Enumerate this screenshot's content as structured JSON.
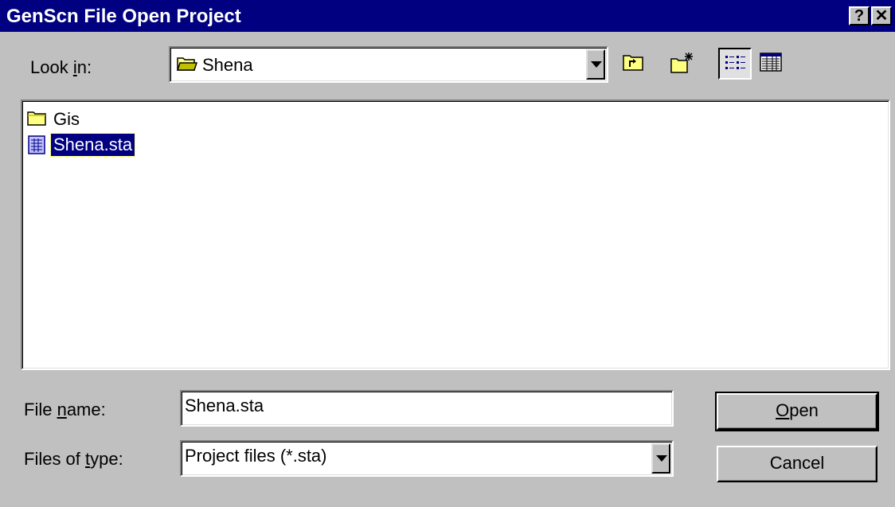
{
  "window": {
    "title": "GenScn File Open Project",
    "help_button": "?",
    "close_button": "✕"
  },
  "look_in": {
    "label_pre": "Look ",
    "label_accel": "i",
    "label_post": "n:",
    "value": "Shena"
  },
  "toolbar": {
    "icons": [
      "up-one-level-icon",
      "create-new-folder-icon",
      "list-view-icon",
      "details-view-icon"
    ]
  },
  "files": {
    "items": [
      {
        "name": "Gis",
        "icon": "folder-icon",
        "selected": false
      },
      {
        "name": "Shena.sta",
        "icon": "project-file-icon",
        "selected": true
      }
    ]
  },
  "file_name": {
    "label_pre": "File ",
    "label_accel": "n",
    "label_post": "ame:",
    "value": "Shena.sta"
  },
  "file_type": {
    "label_pre": "Files of ",
    "label_accel": "t",
    "label_post": "ype:",
    "value": "Project files (*.sta)"
  },
  "buttons": {
    "open_accel": "O",
    "open_rest": "pen",
    "cancel": "Cancel"
  },
  "colors": {
    "title_bar": "#000080",
    "face": "#c0c0c0",
    "selection": "#000080"
  }
}
